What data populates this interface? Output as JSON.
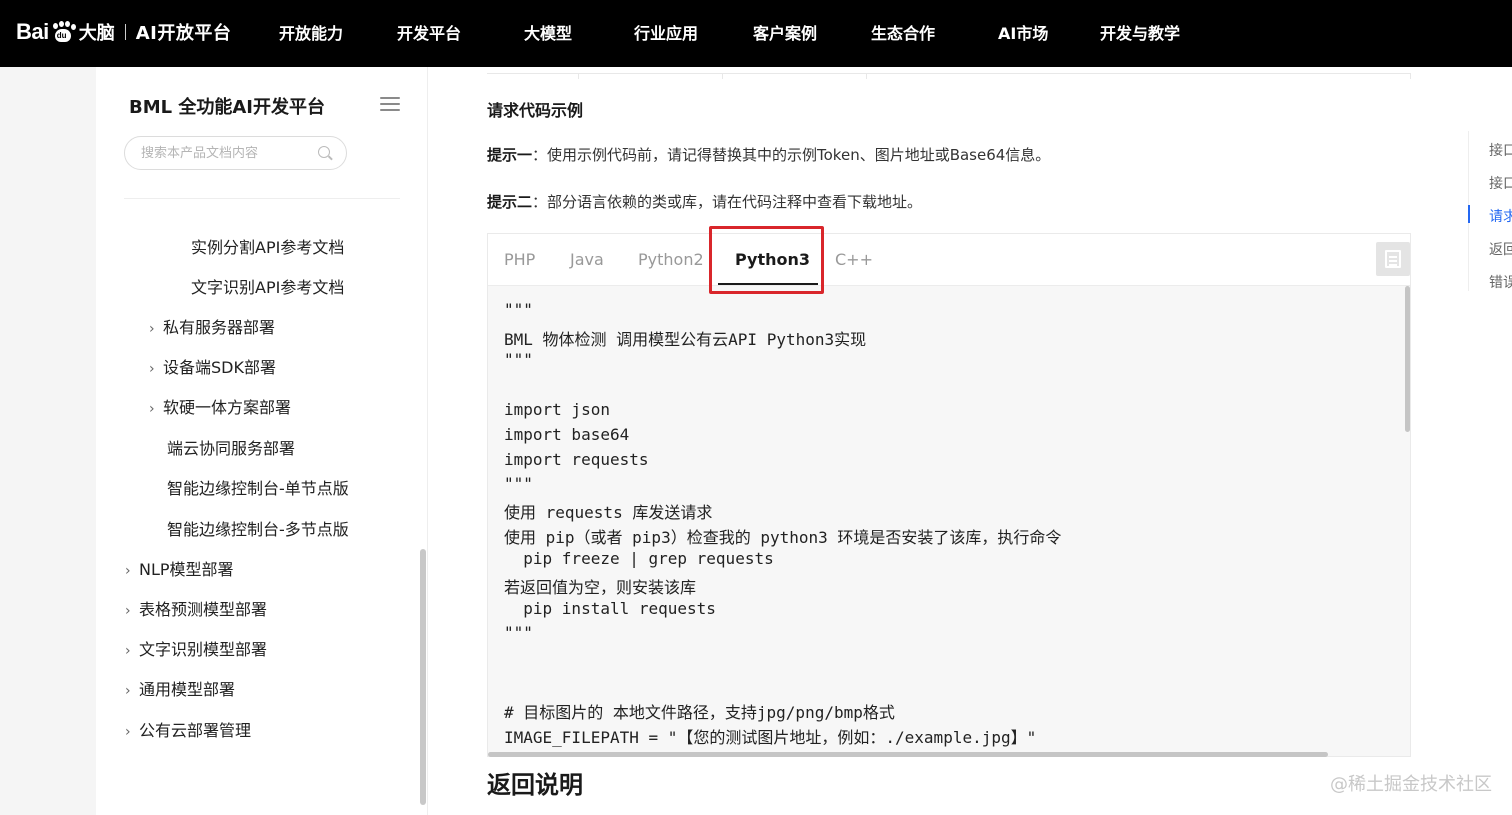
{
  "brand": {
    "bai": "Bai",
    "paw_text": "du",
    "name": "大脑",
    "platform": "AI开放平台"
  },
  "nav": [
    "开放能力",
    "开发平台",
    "大模型",
    "行业应用",
    "客户案例",
    "生态合作",
    "AI市场",
    "开发与教学"
  ],
  "sidebar": {
    "title": "BML 全功能AI开发平台",
    "search_placeholder": "搜索本产品文档内容",
    "items": [
      {
        "label": "实例分割API参考文档",
        "expandable": false
      },
      {
        "label": "文字识别API参考文档",
        "expandable": false
      },
      {
        "label": "私有服务器部署",
        "expandable": true
      },
      {
        "label": "设备端SDK部署",
        "expandable": true
      },
      {
        "label": "软硬一体方案部署",
        "expandable": true
      },
      {
        "label": "端云协同服务部署",
        "expandable": false
      },
      {
        "label": "智能边缘控制台-单节点版",
        "expandable": false
      },
      {
        "label": "智能边缘控制台-多节点版",
        "expandable": false
      },
      {
        "label": "NLP模型部署",
        "expandable": true
      },
      {
        "label": "表格预测模型部署",
        "expandable": true
      },
      {
        "label": "文字识别模型部署",
        "expandable": true
      },
      {
        "label": "通用模型部署",
        "expandable": true
      },
      {
        "label": "公有云部署管理",
        "expandable": true
      }
    ],
    "chevron": "›"
  },
  "main": {
    "section_title": "请求代码示例",
    "tip1_label": "提示一",
    "tip1_text": "：使用示例代码前，请记得替换其中的示例Token、图片地址或Base64信息。",
    "tip2_label": "提示二",
    "tip2_text": "：部分语言依赖的类或库，请在代码注释中查看下载地址。",
    "tabs": [
      "PHP",
      "Java",
      "Python2",
      "Python3",
      "C++"
    ],
    "active_tab": "Python3",
    "code_lines": [
      "\"\"\"",
      "BML 物体检测 调用模型公有云API Python3实现",
      "\"\"\"",
      "",
      "import json",
      "import base64",
      "import requests",
      "\"\"\"",
      "使用 requests 库发送请求",
      "使用 pip（或者 pip3）检查我的 python3 环境是否安装了该库，执行命令",
      "  pip freeze | grep requests",
      "若返回值为空，则安装该库",
      "  pip install requests",
      "\"\"\"",
      "",
      "",
      "",
      "# 目标图片的 本地文件路径，支持jpg/png/bmp格式",
      "IMAGE_FILEPATH = \"【您的测试图片地址，例如：./example.jpg】\""
    ],
    "next_section": "返回说明"
  },
  "toc": [
    "接口",
    "接口",
    "请求",
    "返回",
    "错误"
  ],
  "toc_active": "请求",
  "watermark": "@稀土掘金技术社区",
  "colors": {
    "accent": "#2468f2",
    "highlight_box": "#d9262b"
  }
}
